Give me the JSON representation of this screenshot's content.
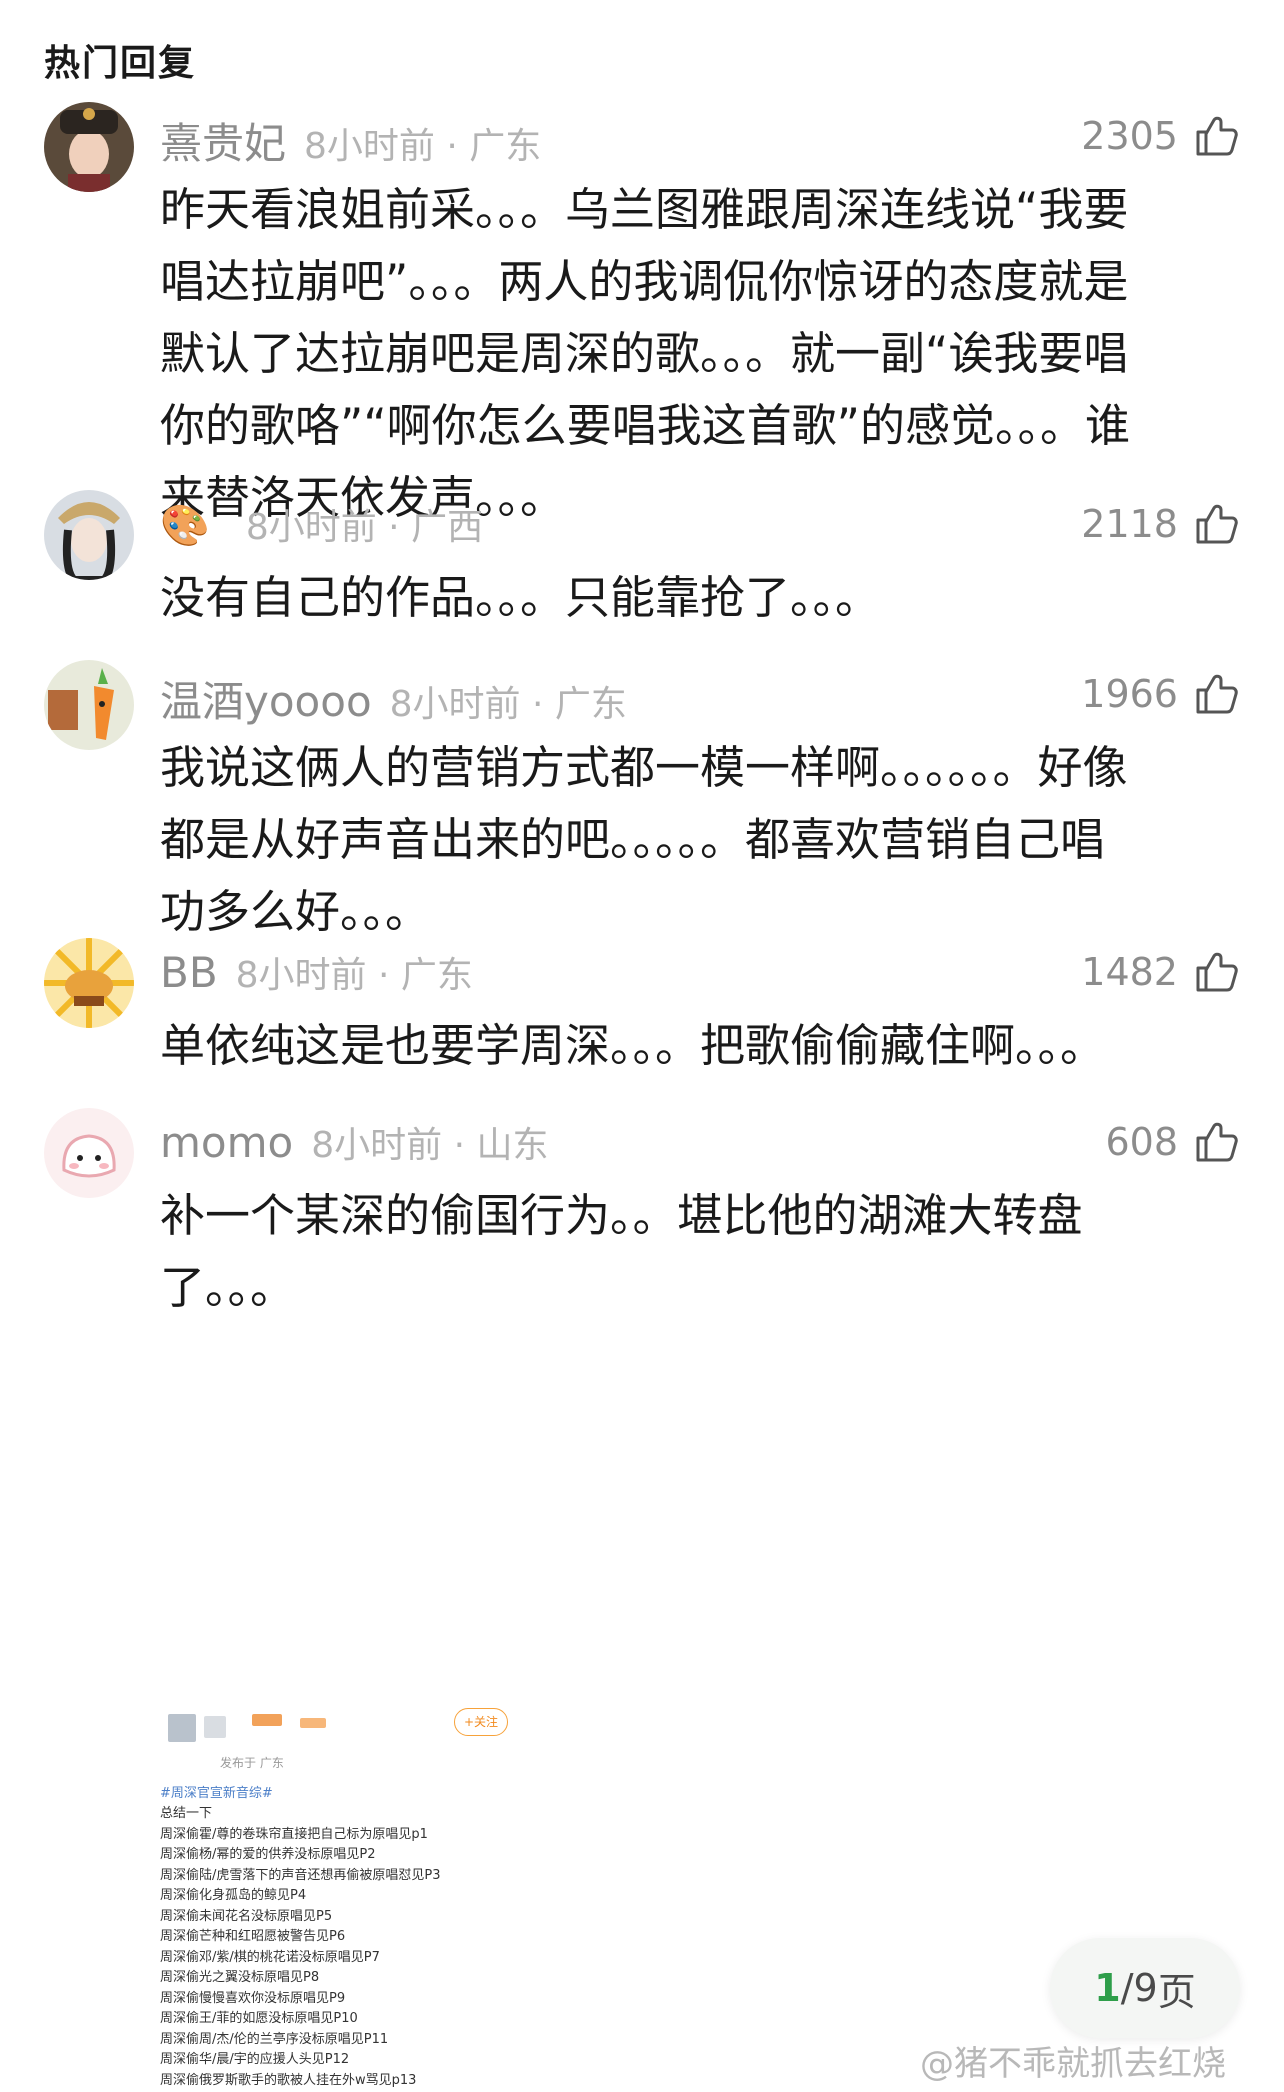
{
  "section_title": "热门回复",
  "comments": [
    {
      "username": "熹贵妃",
      "time": "8小时前",
      "location": "广东",
      "likes": "2305",
      "text": "昨天看浪姐前采。。。乌兰图雅跟周深连线说“我要\n唱达拉崩吧”。。。两人的我调侃你惊讶的态度就是\n默认了达拉崩吧是周深的歌。。。就一副“诶我要唱\n你的歌咯”“啊你怎么要唱我这首歌”的感觉。。。谁\n来替洛天依发声。。。"
    },
    {
      "username": "",
      "username_icon": "palette-icon",
      "time": "8小时前",
      "location": "广西",
      "likes": "2118",
      "text": "没有自己的作品。。。只能靠抢了。。。"
    },
    {
      "username": "温酒yoooo",
      "time": "8小时前",
      "location": "广东",
      "likes": "1966",
      "text": "我说这俩人的营销方式都一模一样啊。。。。。。好像\n都是从好声音出来的吧。。。。。都喜欢营销自己唱\n功多么好。。。"
    },
    {
      "username": "BB",
      "time": "8小时前",
      "location": "广东",
      "likes": "1482",
      "text": "单依纯这是也要学周深。。。把歌偷偷藏住啊。。。"
    },
    {
      "username": "momo",
      "time": "8小时前",
      "location": "山东",
      "likes": "608",
      "text": "补一个某深的偷国行为。。堪比他的湖滩大转盘\n了。。。"
    }
  ],
  "embedded_post": {
    "follow_label": "+关注",
    "time": "发布于 广东",
    "tag": "#周深官宣新音综#",
    "lines": [
      "总结一下",
      "周深偷霍/尊的卷珠帘直接把自己标为原唱见p1",
      "周深偷杨/幂的爱的供养没标原唱见P2",
      "周深偷陆/虎雪落下的声音还想再偷被原唱怼见P3",
      "周深偷化身孤岛的鲸见P4",
      "周深偷未闻花名没标原唱见P5",
      "周深偷芒种和红昭愿被警告见P6",
      "周深偷邓/紫/棋的桃花诺没标原唱见P7",
      "周深偷光之翼没标原唱见P8",
      "周深偷慢慢喜欢你没标原唱见P9",
      "周深偷王/菲的如愿没标原唱见P10",
      "周深偷周/杰/伦的兰亭序没标原唱见P11",
      "周深偷华/晨/宇的应援人头见P12",
      "周深偷俄罗斯歌手的歌被人挂在外w骂见p13"
    ]
  },
  "pager": {
    "current": "1",
    "total": "/9",
    "unit": " 页"
  },
  "watermark": "@猪不乖就抓去红烧",
  "colors": {
    "accent_green": "#2e9e4a",
    "follow_orange": "#f28a1e",
    "tag_blue": "#4c7fc8"
  }
}
